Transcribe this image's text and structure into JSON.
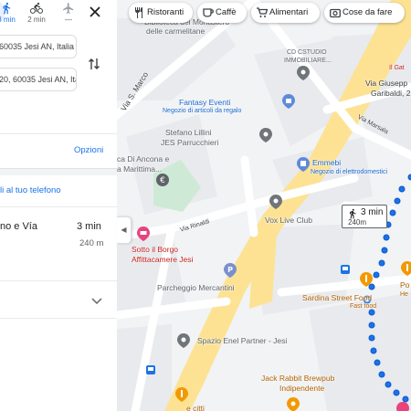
{
  "panel": {
    "modes": [
      {
        "icon": "walk-icon",
        "label": "3 min",
        "selected": true
      },
      {
        "icon": "bike-icon",
        "label": "2 min",
        "selected": false
      },
      {
        "icon": "airplane-icon",
        "label": "—",
        "selected": false
      }
    ],
    "origin_value": "60035 Jesi AN, Italia",
    "destination_value": "20, 60035 Jesi AN, Italia",
    "options_label": "Opzioni",
    "send_to_phone_label": "li al tuo telefono",
    "route": {
      "title": "no e Vía",
      "time": "3 min",
      "distance": "240 m"
    }
  },
  "chips": [
    {
      "icon": "restaurant-icon",
      "label": "Ristoranti"
    },
    {
      "icon": "coffee-icon",
      "label": "Caffè"
    },
    {
      "icon": "cart-icon",
      "label": "Alimentari"
    },
    {
      "icon": "camera-icon",
      "label": "Cose da fare"
    }
  ],
  "map": {
    "walk_box": {
      "time": "3 min",
      "distance": "240m"
    },
    "labels": {
      "carmelitane_top": "Biblioteca del Monastero",
      "carmelitane": "delle carmelitane",
      "cd_studio_1": "CD CSTUDIO",
      "cd_studio_2": "IMMOBILIARE...",
      "via_s_marco": "Via S. Marco",
      "il_gat": "Il Gat",
      "via_giuseppe_1": "Via Giusepp",
      "via_giuseppe_2": "Garibaldi, 2",
      "via_marsala": "Via Marsala",
      "fantasy_1": "Fantasy Eventi",
      "fantasy_2": "Negozio di articoli da regalo",
      "stefano_1": "Stefano Lillini",
      "stefano_2": "JES Parrucchieri",
      "banca_1": "ca Di Ancona e",
      "banca_2": "a Marittima...",
      "emmebi_1": "Emmebi",
      "emmebi_2": "Negozio di elettrodomestici",
      "via_rinaldi": "Via Rinaldi",
      "vox": "Vox Live Club",
      "sotto_1": "Sotto il Borgo",
      "sotto_2": "Affittacamere Jesi",
      "parcheggio": "Parcheggio Mercantini",
      "sardina": "Sardina Street Food",
      "fast_food": "Fast food",
      "spazio": "Spazio Enel Partner - Jesi",
      "jack_1": "Jack Rabbit Brewpub",
      "jack_2": "Indipendente",
      "po": "Po",
      "he": "He",
      "citti": "e citti"
    }
  },
  "colors": {
    "accent": "#1a73e8",
    "route_dot": "#1a73e8",
    "road": "#ffffff",
    "block": "#e8eaed",
    "green": "#ceead6",
    "pink_pin": "#e8437a",
    "grey_pin": "#5f6368",
    "blue_pin": "#5e8bd9",
    "orange_pin": "#f29900"
  }
}
